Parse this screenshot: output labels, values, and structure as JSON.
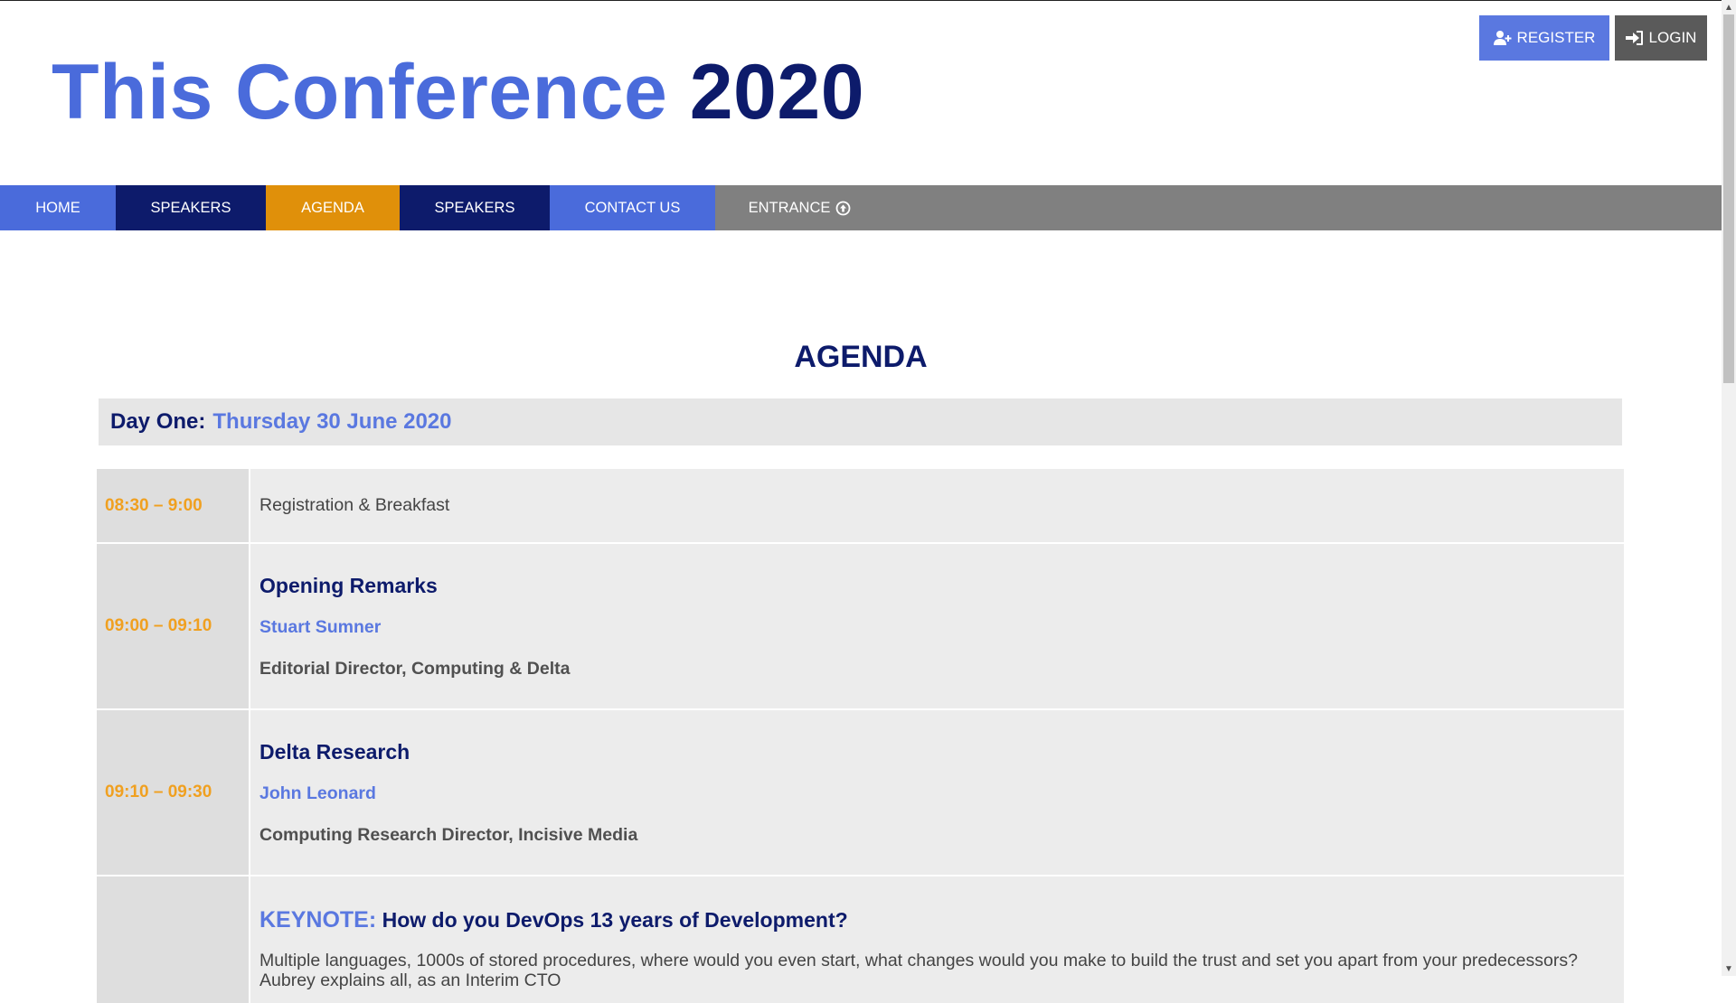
{
  "header": {
    "title_part1": "This Conference",
    "title_part2": "2020",
    "register_label": "REGISTER",
    "login_label": "LOGIN",
    "register_icon": "user-plus-icon",
    "login_icon": "sign-in-icon"
  },
  "nav": {
    "items": [
      {
        "label": "HOME",
        "bg": "#4a6bdb"
      },
      {
        "label": "SPEAKERS",
        "bg": "#0d1b6b"
      },
      {
        "label": "AGENDA",
        "bg": "#e0900a"
      },
      {
        "label": "SPEAKERS",
        "bg": "#0d1b6b"
      },
      {
        "label": "CONTACT US",
        "bg": "#4a6bdb"
      },
      {
        "label": "ENTRANCE",
        "bg": "#808080",
        "icon": "arrow-circle-up-icon"
      }
    ]
  },
  "agenda": {
    "heading": "AGENDA",
    "day_label": "Day One:",
    "day_date": "Thursday 30 June 2020",
    "sessions": [
      {
        "time": "08:30 – 9:00",
        "text": "Registration & Breakfast"
      },
      {
        "time": "09:00 – 09:10",
        "title": "Opening Remarks",
        "speaker": "Stuart Sumner",
        "role": "Editorial Director, Computing & Delta"
      },
      {
        "time": "09:10 – 09:30",
        "title": "Delta Research",
        "speaker": "John Leonard",
        "role": "Computing Research Director, Incisive Media"
      },
      {
        "time": "",
        "tag": "KEYNOTE:",
        "title": "How do you DevOps 13 years of Development?",
        "description": "Multiple languages, 1000s of stored procedures, where would you even start, what changes would you make to build the trust and set you apart from your predecessors? Aubrey explains all, as an Interim CTO"
      }
    ]
  },
  "colors": {
    "brand_blue": "#4a6bdb",
    "navy": "#0d1b6b",
    "orange": "#f0a020",
    "gray": "#808080"
  }
}
